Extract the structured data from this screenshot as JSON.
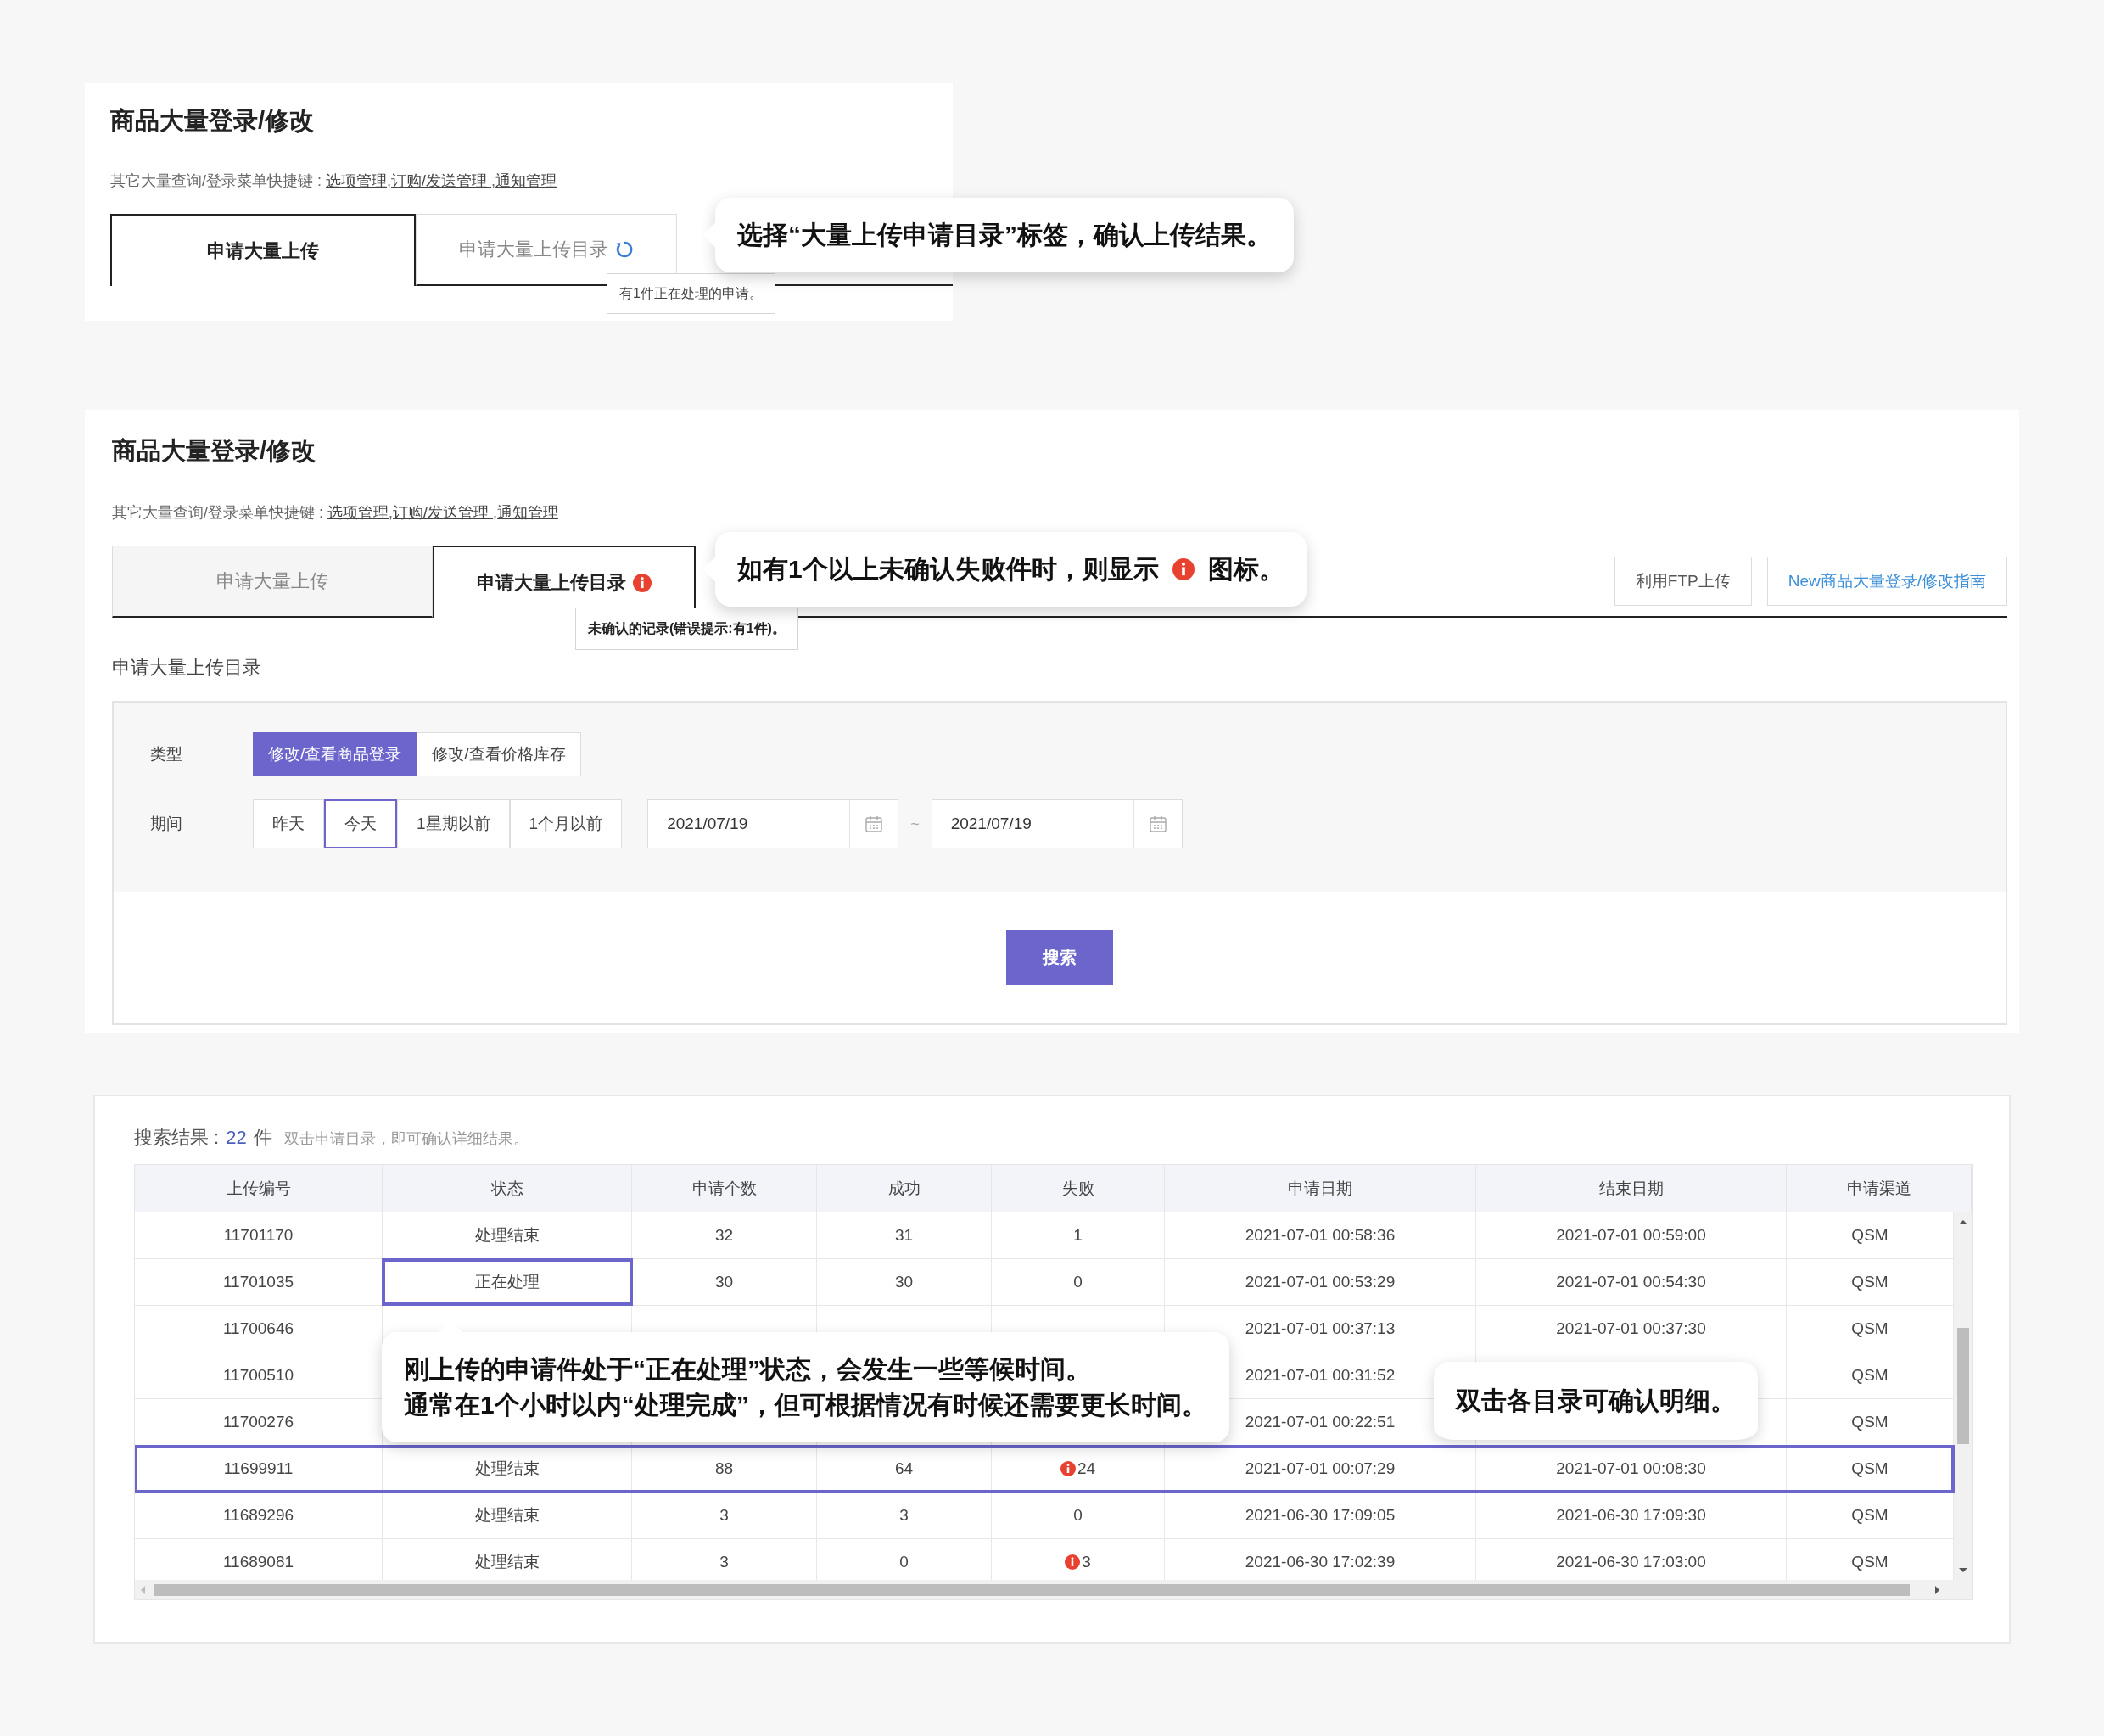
{
  "step1": {
    "title": "商品大量登录/修改",
    "shortcut_label": "其它大量查询/登录菜单快捷键 :",
    "link_separator": ",",
    "shortcut_links": [
      "选项管理",
      "订购/发送管理 ",
      "通知管理"
    ],
    "tabs": [
      {
        "label": "申请大量上传",
        "selected": true,
        "loading": false
      },
      {
        "label": "申请大量上传目录",
        "selected": false,
        "loading": true
      }
    ],
    "tooltip": "有1件正在处理的申请。",
    "callout": "选择“大量上传申请目录”标签，确认上传结果。"
  },
  "step2": {
    "title": "商品大量登录/修改",
    "shortcut_label": "其它大量查询/登录菜单快捷键 :",
    "link_separator": ",",
    "shortcut_links": [
      "选项管理",
      "订购/发送管理 ",
      "通知管理"
    ],
    "tabs": [
      {
        "label": "申请大量上传",
        "selected": false,
        "error": false
      },
      {
        "label": "申请大量上传目录",
        "selected": true,
        "error": true
      }
    ],
    "buttons": [
      {
        "label": "利用FTP上传",
        "kind": "plain"
      },
      {
        "label": "New商品大量登录/修改指南",
        "kind": "link"
      }
    ],
    "tooltip": "未确认的记录(错误提示:有1件)。",
    "callout": {
      "before": "如有1个以上未确认失败件时，则显示",
      "after": "图标。"
    },
    "section_title": "申请大量上传目录",
    "filters": {
      "type_label": "类型",
      "type_options": [
        {
          "label": "修改/查看商品登录",
          "selected": true
        },
        {
          "label": "修改/查看价格库存",
          "selected": false
        }
      ],
      "period_label": "期间",
      "period_options": [
        {
          "label": "昨天",
          "selected": false
        },
        {
          "label": "今天",
          "selected": true
        },
        {
          "label": "1星期以前",
          "selected": false
        },
        {
          "label": "1个月以前",
          "selected": false
        }
      ],
      "date_from": "2021/07/19",
      "range_separator": "~",
      "date_to": "2021/07/19"
    },
    "search_button": "搜索"
  },
  "step3": {
    "result_label": "搜索结果 :",
    "count": "22",
    "count_unit": "件",
    "hint": "双击申请目录，即可确认详细结果。",
    "columns": [
      "上传编号",
      "状态",
      "申请个数",
      "成功",
      "失败",
      "申请日期",
      "结束日期",
      "申请渠道"
    ],
    "rows": [
      {
        "id": "11701170",
        "status": "处理结束",
        "count": "32",
        "success": "31",
        "fail": "1",
        "fail_alert": false,
        "start": "2021-07-01 00:58:36",
        "end": "2021-07-01 00:59:00",
        "channel": "QSM",
        "outlined": false,
        "status_outlined": false
      },
      {
        "id": "11701035",
        "status": "正在处理",
        "count": "30",
        "success": "30",
        "fail": "0",
        "fail_alert": false,
        "start": "2021-07-01 00:53:29",
        "end": "2021-07-01 00:54:30",
        "channel": "QSM",
        "outlined": false,
        "status_outlined": true
      },
      {
        "id": "11700646",
        "start": "2021-07-01 00:37:13",
        "end": "2021-07-01 00:37:30",
        "channel": "QSM",
        "outlined": false
      },
      {
        "id": "11700510",
        "start": "2021-07-01 00:31:52",
        "channel": "QSM",
        "outlined": false
      },
      {
        "id": "11700276",
        "start": "2021-07-01 00:22:51",
        "channel": "QSM",
        "outlined": false
      },
      {
        "id": "11699911",
        "status": "处理结束",
        "count": "88",
        "success": "64",
        "fail": "24",
        "fail_alert": true,
        "start": "2021-07-01 00:07:29",
        "end": "2021-07-01 00:08:30",
        "channel": "QSM",
        "outlined": true,
        "status_outlined": false
      },
      {
        "id": "11689296",
        "status": "处理结束",
        "count": "3",
        "success": "3",
        "fail": "0",
        "fail_alert": false,
        "start": "2021-06-30 17:09:05",
        "end": "2021-06-30 17:09:30",
        "channel": "QSM",
        "outlined": false,
        "status_outlined": false
      },
      {
        "id": "11689081",
        "status": "处理结束",
        "count": "3",
        "success": "0",
        "fail": "3",
        "fail_alert": true,
        "start": "2021-06-30 17:02:39",
        "end": "2021-06-30 17:03:00",
        "channel": "QSM",
        "outlined": false,
        "status_outlined": false
      }
    ],
    "callouts": [
      {
        "lines": [
          "刚上传的申请件处于“正在处理”状态，会发生一些等候时间。",
          "通常在1个小时以内“处理完成”，但可根据情况有时候还需要更长时间。"
        ]
      },
      {
        "lines": [
          "双击各目录可确认明细。"
        ]
      }
    ]
  }
}
